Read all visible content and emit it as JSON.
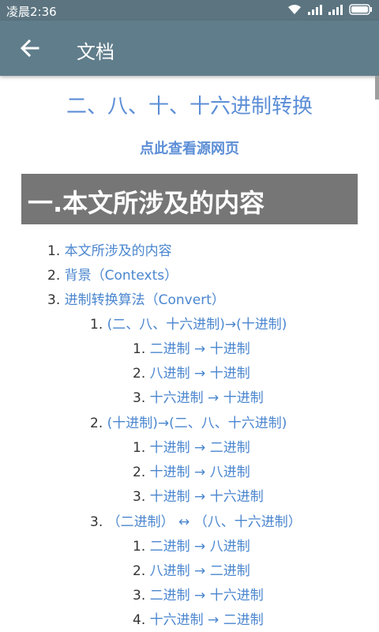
{
  "status": {
    "time": "凌晨2:36"
  },
  "toolbar": {
    "title": "文档"
  },
  "document": {
    "title": "二、八、十、十六进制转换",
    "source_link": "点此查看源网页",
    "section_heading": "一.本文所涉及的内容"
  },
  "toc": {
    "items": [
      {
        "num": "1.",
        "text": "本文所涉及的内容"
      },
      {
        "num": "2.",
        "text": "背景（Contexts）"
      },
      {
        "num": "3.",
        "text": "进制转换算法（Convert）"
      }
    ],
    "sub1": {
      "num": "1.",
      "text": "(二、八、十六进制)→(十进制)"
    },
    "sub1_items": [
      {
        "num": "1.",
        "text": "二进制 → 十进制"
      },
      {
        "num": "2.",
        "text": "八进制 → 十进制"
      },
      {
        "num": "3.",
        "text": "十六进制 → 十进制"
      }
    ],
    "sub2": {
      "num": "2.",
      "text": "(十进制)→(二、八、十六进制)"
    },
    "sub2_items": [
      {
        "num": "1.",
        "text": "十进制 → 二进制"
      },
      {
        "num": "2.",
        "text": "十进制 → 八进制"
      },
      {
        "num": "3.",
        "text": "十进制 → 十六进制"
      }
    ],
    "sub3": {
      "num": "3.",
      "text": "（二进制） ↔ （八、十六进制）"
    },
    "sub3_items": [
      {
        "num": "1.",
        "text": "二进制 → 八进制"
      },
      {
        "num": "2.",
        "text": "八进制 → 二进制"
      },
      {
        "num": "3.",
        "text": "二进制 → 十六进制"
      },
      {
        "num": "4.",
        "text": "十六进制 → 二进制"
      }
    ]
  }
}
